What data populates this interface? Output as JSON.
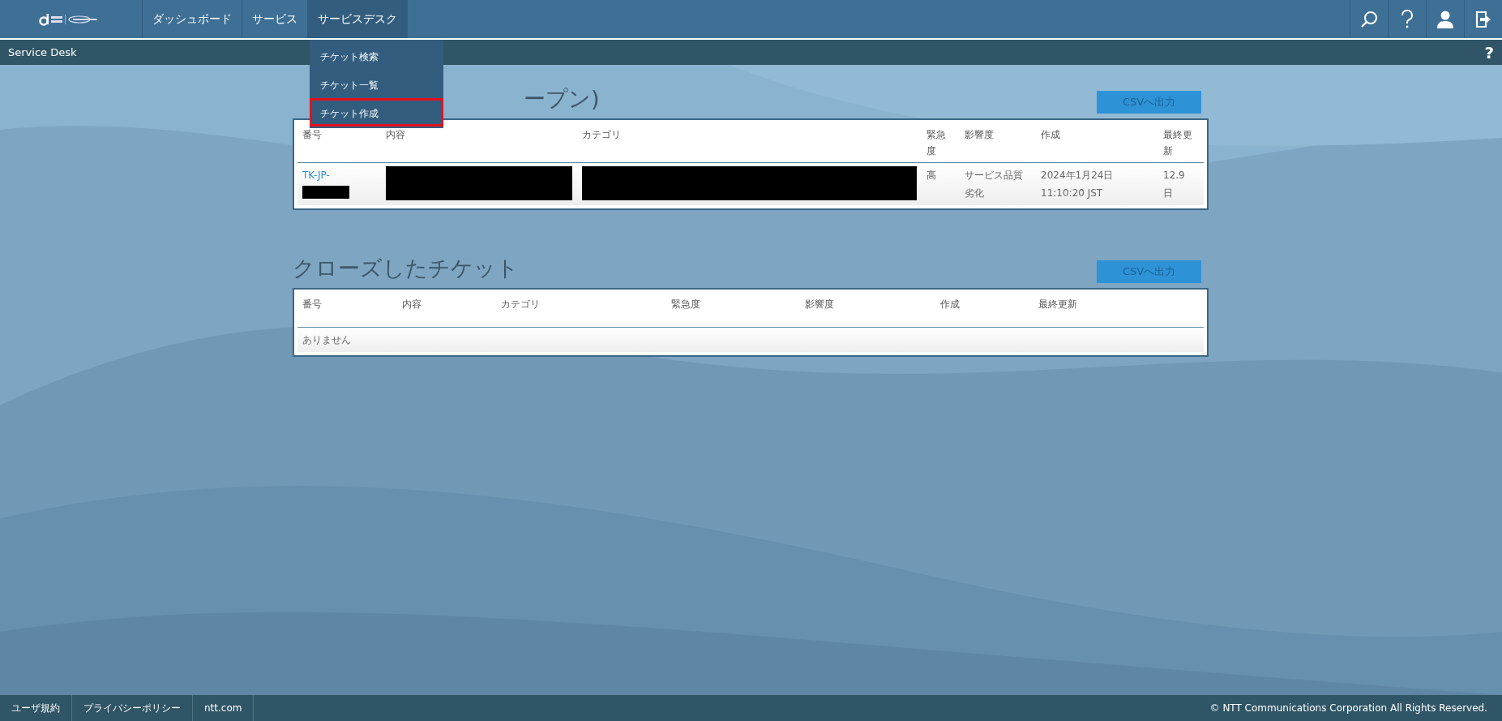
{
  "header": {
    "nav": [
      {
        "label": "ダッシュボード",
        "selected": false
      },
      {
        "label": "サービス",
        "selected": false
      },
      {
        "label": "サービスデスク",
        "selected": true
      }
    ],
    "dropdown": [
      {
        "label": "チケット検索",
        "highlighted": false
      },
      {
        "label": "チケット一覧",
        "highlighted": false
      },
      {
        "label": "チケット作成",
        "highlighted": true
      }
    ],
    "actions": [
      {
        "kind": "search"
      },
      {
        "kind": "help"
      },
      {
        "kind": "user"
      },
      {
        "kind": "logout"
      }
    ]
  },
  "subheader": {
    "title": "Service Desk",
    "help": "?"
  },
  "open_tickets": {
    "title": "ープン)",
    "csv_button": "CSVへ出力",
    "columns": [
      "番号",
      "内容",
      "カテゴリ",
      "緊急度",
      "影響度",
      "作成",
      "最終更新"
    ],
    "rows": [
      {
        "number": "TK-JP-",
        "number_redacted": true,
        "content_redacted": true,
        "category_redacted": true,
        "urgency": "高",
        "impact": "サービス品質劣化",
        "created": "2024年1月24日 11:10:20 JST",
        "updated": "12.9 日"
      }
    ]
  },
  "closed_tickets": {
    "title": "クローズしたチケット",
    "csv_button": "CSVへ出力",
    "columns": [
      "番号",
      "内容",
      "カテゴリ",
      "緊急度",
      "影響度",
      "作成",
      "最終更新"
    ],
    "empty_text": "ありません"
  },
  "footer": {
    "links": [
      "ユーザ規約",
      "プライバシーポリシー",
      "ntt.com"
    ],
    "copyright": "© NTT Communications Corporation All Rights Reserved."
  }
}
